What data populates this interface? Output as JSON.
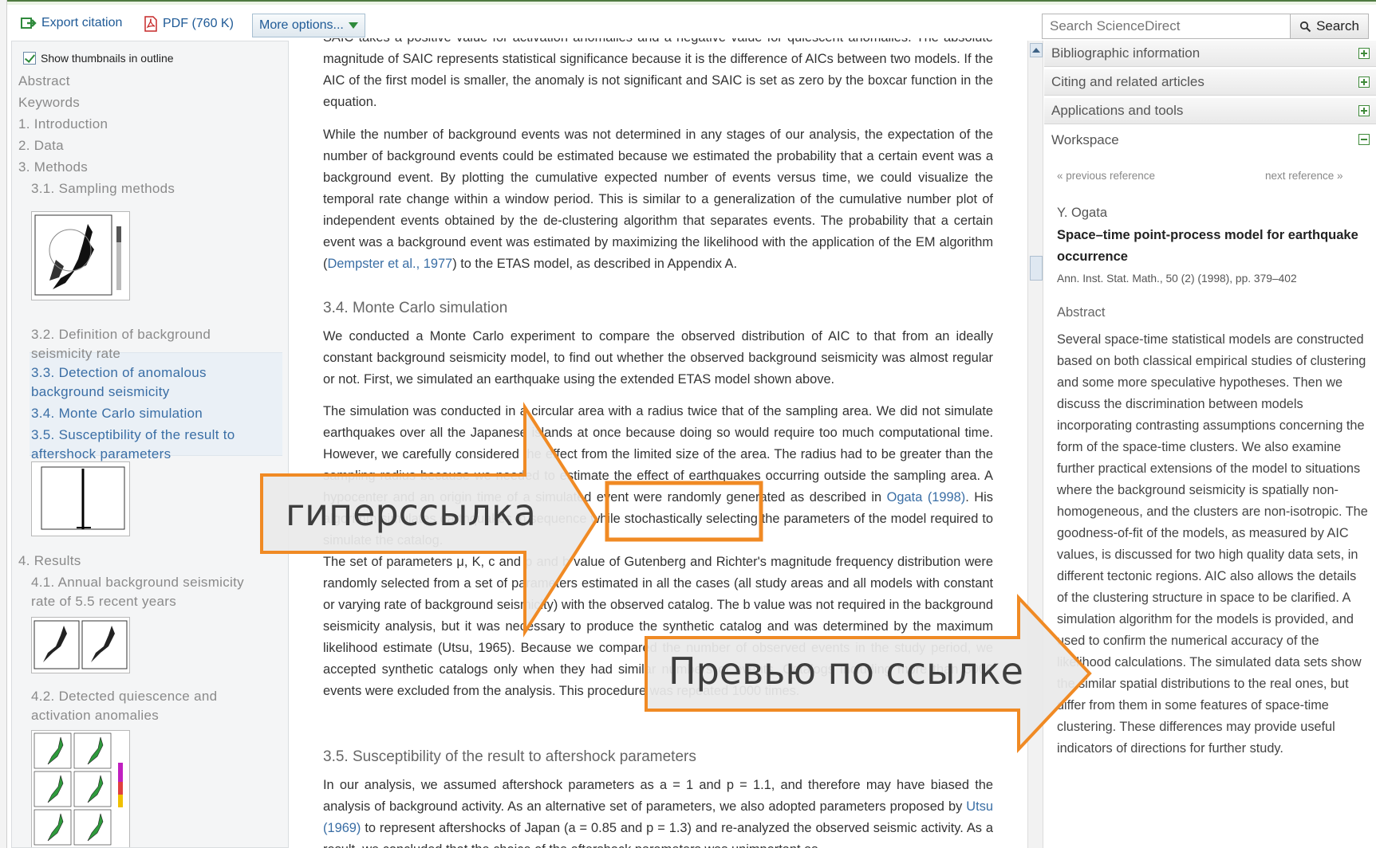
{
  "toolbar": {
    "export_citation": "Export citation",
    "pdf": "PDF (760 K)",
    "more_options": "More options..."
  },
  "search": {
    "placeholder": "Search ScienceDirect",
    "button": "Search"
  },
  "outline": {
    "show_thumbnails": "Show thumbnails in outline",
    "items": [
      "Abstract",
      "Keywords",
      "1. Introduction",
      "2. Data",
      "3. Methods",
      "3.1. Sampling methods",
      "3.2. Definition of background",
      "seismicity rate",
      "3.3. Detection of anomalous",
      "background seismicity",
      "3.4. Monte Carlo simulation",
      "3.5. Susceptibility of the result to",
      "aftershock parameters",
      "4. Results",
      "4.1. Annual background seismicity",
      "rate of 5.5 recent years",
      "4.2. Detected quiescence and",
      "activation anomalies"
    ]
  },
  "article": {
    "p0": "SAIC takes a positive value for activation anomalies and a negative value for quiescent anomalies. The absolute magnitude of SAIC represents statistical significance because it is the difference of AICs between two models. If the AIC of the first model is smaller, the anomaly is not significant and SAIC is set as zero by the boxcar function in the equation.",
    "p1a": "While the number of background events was not determined in any stages of our analysis, the expectation of the number of background events could be estimated because we estimated the probability that a certain event was a background event. By plotting the cumulative expected number of events versus time, we could visualize the temporal rate change within a window period. This is similar to a generalization of the cumulative number plot of independent events obtained by the de-clustering algorithm that separates events. The probability that a certain event was a background event was estimated by maximizing the likelihood with the application of the EM algorithm (",
    "p1link": "Dempster et al., 1977",
    "p1b": ") to the ETAS model, as described in Appendix A.",
    "h34": "3.4. Monte Carlo simulation",
    "p2": "We conducted a Monte Carlo experiment to compare the observed distribution of AIC to that from an ideally constant background seismicity model, to find out whether the observed background seismicity was almost regular or not. First, we simulated an earthquake using the extended ETAS model shown above.",
    "p3a": "The simulation was conducted in a circular area with a radius twice that of the sampling area. We did not simulate earthquakes over all the Japanese islands at once because doing so would require too much computational time. However, we carefully considered the effect from the limited size of the area. The radius had to be greater than the sampling radius because we needed to estimate the effect of earthquakes occurring outside the sampling area. A hypocenter and an origin time of a simulated event were randomly generated as described in ",
    "p3link": "Ogata (1998)",
    "p3b": ". His algorithm simulates earthquakes in sequence while stochastically selecting the parameters of the model required to simulate the catalog.",
    "p4": "The set of parameters μ, K, c and p and b value of Gutenberg and Richter's magnitude frequency distribution were randomly selected from a set of parameters estimated in all the cases (all study areas and all models with constant or varying rate of background seismicity) with the observed catalog. The b value was not required in the background seismicity analysis, but it was necessary to produce the synthetic catalog and was determined by the maximum likelihood estimate (Utsu, 1965). Because we compared the number of observed events in the study period, we accepted synthetic catalogs only when they had similar numbers of events. Catalogs including more than 3000 events were excluded from the analysis. This procedure was repeated 1000 times.",
    "h35": "3.5. Susceptibility of the result to aftershock parameters",
    "p5a": "In our analysis, we assumed aftershock parameters as a = 1 and p = 1.1, and therefore may have biased the analysis of background activity. As an alternative set of parameters, we also adopted parameters proposed by ",
    "p5link": "Utsu (1969)",
    "p5b": " to represent aftershocks of Japan (a = 0.85 and p = 1.3) and re-analyzed the observed seismic activity. As a result, we concluded that the choice of the aftershock parameters was unimportant as"
  },
  "sidebar": {
    "bibliographic": "Bibliographic information",
    "citing": "Citing and related articles",
    "applications": "Applications and tools",
    "workspace": "Workspace",
    "prev_ref": "« previous reference",
    "next_ref": "next reference »",
    "author": "Y. Ogata",
    "ref_title": "Space–time point-process model for earthquake occurrence",
    "ref_source": "Ann. Inst. Stat. Math., 50 (2) (1998), pp. 379–402",
    "abstract_heading": "Abstract",
    "abstract": "Several space-time statistical models are constructed based on both classical empirical studies of clustering and some more speculative hypotheses. Then we discuss the discrimination between models incorporating contrasting assumptions concerning the form of the space-time clusters. We also examine further practical extensions of the model to situations where the background seismicity is spatially non-homogeneous, and the clusters are non-isotropic. The goodness-of-fit of the models, as measured by AIC values, is discussed for two high quality data sets, in different tectonic regions. AIC also allows the details of the clustering structure in space to be clarified. A simulation algorithm for the models is provided, and used to confirm the numerical accuracy of the likelihood calculations. The simulated data sets show the similar spatial distributions to the real ones, but differ from them in some features of space-time clustering. These differences may provide useful indicators of directions for further study."
  },
  "annotations": {
    "hyperlink": "гиперссылка",
    "preview": "Превью по ссылке"
  },
  "colors": {
    "accent_orange": "#f08a24",
    "link_blue": "#3a6ea5",
    "green": "#4f7a41"
  }
}
